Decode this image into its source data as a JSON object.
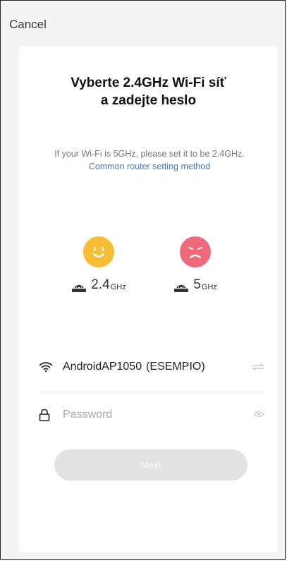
{
  "header": {
    "cancel_label": "Cancel"
  },
  "title": {
    "line1": "Vyberte 2.4GHz Wi-Fi síť",
    "line2": "a zadejte heslo"
  },
  "hint": {
    "text": "If your Wi-Fi is 5GHz, please set it to be 2.4GHz.",
    "link": "Common router setting method"
  },
  "bands": [
    {
      "value": "2.4",
      "unit": "GHz",
      "face": "smile-face-icon",
      "color": "#f7bd35"
    },
    {
      "value": "5",
      "unit": "GHz",
      "face": "sad-face-icon",
      "color": "#ee6a7b"
    }
  ],
  "network": {
    "ssid": "AndroidAP1050",
    "example_note": "(ESEMPIO)"
  },
  "password": {
    "placeholder": "Password",
    "value": ""
  },
  "next_label": "Next"
}
